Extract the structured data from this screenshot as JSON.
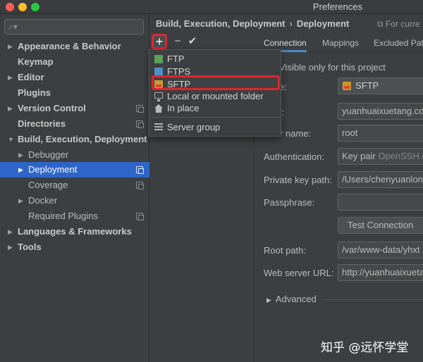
{
  "window": {
    "title": "Preferences"
  },
  "search": {
    "icon": "search-icon",
    "value": ""
  },
  "sidebar": {
    "items": [
      {
        "label": "Appearance & Behavior",
        "arrow": "▶",
        "bold": true
      },
      {
        "label": "Keymap",
        "arrow": "",
        "bold": true
      },
      {
        "label": "Editor",
        "arrow": "▶",
        "bold": true
      },
      {
        "label": "Plugins",
        "arrow": "",
        "bold": true
      },
      {
        "label": "Version Control",
        "arrow": "▶",
        "bold": true
      },
      {
        "label": "Directories",
        "arrow": "",
        "bold": true
      },
      {
        "label": "Build, Execution, Deployment",
        "arrow": "▼",
        "bold": true
      },
      {
        "label": "Debugger",
        "arrow": "▶",
        "bold": false
      },
      {
        "label": "Deployment",
        "arrow": "▶",
        "bold": false
      },
      {
        "label": "Coverage",
        "arrow": "",
        "bold": false
      },
      {
        "label": "Docker",
        "arrow": "▶",
        "bold": false
      },
      {
        "label": "Required Plugins",
        "arrow": "",
        "bold": false
      },
      {
        "label": "Languages & Frameworks",
        "arrow": "▶",
        "bold": true
      },
      {
        "label": "Tools",
        "arrow": "▶",
        "bold": true
      }
    ]
  },
  "breadcrumb": {
    "parent": "Build, Execution, Deployment",
    "separator": "›",
    "current": "Deployment",
    "scope_note": "For curre"
  },
  "toolbar": {
    "add": "+",
    "remove": "−",
    "apply": "✔"
  },
  "tabs": [
    {
      "label": "Connection"
    },
    {
      "label": "Mappings"
    },
    {
      "label": "Excluded Path"
    }
  ],
  "form": {
    "visible_only": "Visible only for this project",
    "type_label": "e:",
    "type_value": "SFTP",
    "host_label": "t:",
    "host_value": "yuanhuaixuetang.co",
    "username_label": "User name:",
    "username_value": "root",
    "auth_label": "Authentication:",
    "auth_value": "Key pair",
    "auth_hint": "OpenSSH o",
    "private_key_label": "Private key path:",
    "private_key_value": "/Users/chenyuanlong",
    "passphrase_label": "Passphrase:",
    "passphrase_value": "",
    "test_button": "Test Connection",
    "root_path_label": "Root path:",
    "root_path_value": "/var/www-data/yhxt",
    "web_url_label": "Web server URL:",
    "web_url_value": "http://yuanhuaixueta",
    "advanced_label": "Advanced",
    "advanced_arrow": "▶"
  },
  "popup": {
    "items": [
      {
        "label": "FTP"
      },
      {
        "label": "FTPS"
      },
      {
        "label": "SFTP"
      },
      {
        "label": "Local or mounted folder"
      },
      {
        "label": "In place"
      },
      {
        "label": "Server group"
      }
    ]
  },
  "watermark": "知乎 @远怀学堂"
}
